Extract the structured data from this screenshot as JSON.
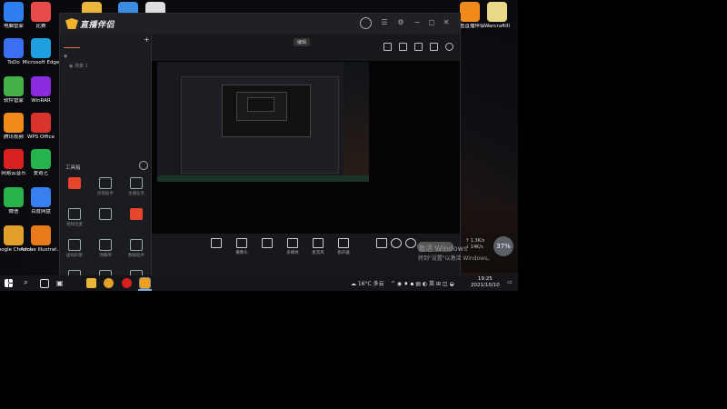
{
  "desktop": {
    "icons": [
      {
        "label": "电脑管家",
        "icon": "shield-icon",
        "color": "#2d7ff0"
      },
      {
        "label": "比赛",
        "icon": "game-icon",
        "color": "#e84a4a"
      },
      {
        "label": "",
        "icon": "folder-icon",
        "color": "#e8b63a"
      },
      {
        "label": "",
        "icon": "app-icon",
        "color": "#3a8de0"
      },
      {
        "label": "",
        "icon": "file-icon",
        "color": "#dddddd"
      },
      {
        "label": "ToDo",
        "icon": "todo-icon",
        "color": "#3a6ff0"
      },
      {
        "label": "Microsoft Edge",
        "icon": "edge-icon",
        "color": "#1fa0e0"
      },
      {
        "label": "软件管家",
        "icon": "software-manager-icon",
        "color": "#43b04a"
      },
      {
        "label": "WinRAR",
        "icon": "winrar-icon",
        "color": "#8a2be2"
      },
      {
        "label": "腾讯视频",
        "icon": "tencent-video-icon",
        "color": "#f08a1a"
      },
      {
        "label": "WPS Office",
        "icon": "wps-icon",
        "color": "#d9332c"
      },
      {
        "label": "网易云音乐",
        "icon": "netease-music-icon",
        "color": "#d8201e"
      },
      {
        "label": "爱奇艺",
        "icon": "iqiyi-icon",
        "color": "#26b24c"
      },
      {
        "label": "微信",
        "icon": "wechat-icon",
        "color": "#2ab24a"
      },
      {
        "label": "百度网盘",
        "icon": "baidu-netdisk-icon",
        "color": "#3a7ff0"
      },
      {
        "label": "Google Chrome",
        "icon": "chrome-icon",
        "color": "#e0a02a"
      },
      {
        "label": "Adobe Illustrat...",
        "icon": "illustrator-icon",
        "color": "#e87a1a"
      },
      {
        "label": "斗鱼直播伴侣",
        "icon": "live-companion-icon",
        "color": "#f08a1a"
      },
      {
        "label": "WarcraftIII",
        "icon": "warcraft-file-icon",
        "color": "#e8d98a"
      }
    ]
  },
  "app": {
    "name": "直播伴侣",
    "left_tabs": [
      "",
      "",
      ""
    ],
    "scenes": [
      "",
      "场景 1"
    ],
    "toolbox_title": "工具箱",
    "tools": [
      {
        "label": "",
        "icon": "camera-icon",
        "hot": true
      },
      {
        "label": "房管助手",
        "icon": "admin-icon",
        "hot": false
      },
      {
        "label": "主播任务",
        "icon": "task-icon",
        "hot": false
      },
      {
        "label": "视频连麦",
        "icon": "video-link-icon",
        "hot": false
      },
      {
        "label": "",
        "icon": "multi-person-icon",
        "hot": false
      },
      {
        "label": "",
        "icon": "hot-tool-icon",
        "hot": true
      },
      {
        "label": "虚拟形象",
        "icon": "avatar-tool-icon",
        "hot": false
      },
      {
        "label": "弹幕库",
        "icon": "danmu-icon",
        "hot": false
      },
      {
        "label": "数据助手",
        "icon": "data-icon",
        "hot": false
      },
      {
        "label": "",
        "icon": "gamepad-icon",
        "hot": false
      },
      {
        "label": "",
        "icon": "download-icon",
        "hot": false
      },
      {
        "label": "",
        "icon": "car-icon",
        "hot": false
      }
    ],
    "notice_prefix": "",
    "notice_text": "",
    "preview": {
      "title": "",
      "edit_label": "编辑",
      "subline": ""
    },
    "bottom_buttons": [
      {
        "label": "",
        "icon": "screen-capture-icon"
      },
      {
        "label": "摄像头",
        "icon": "webcam-icon"
      },
      {
        "label": "",
        "icon": "phone-cast-icon"
      },
      {
        "label": "多媒体",
        "icon": "media-icon"
      },
      {
        "label": "麦克风",
        "icon": "microphone-icon"
      },
      {
        "label": "扬声器",
        "icon": "speaker-icon"
      }
    ],
    "status_line": "",
    "live_button": ""
  },
  "watermark": {
    "line1": "激活 Windows",
    "line2": "转到\"设置\"以激活 Windows。"
  },
  "net_speed": {
    "up": "1.3K/s",
    "down": "14K/s",
    "percent": "37%"
  },
  "taskbar": {
    "weather": "16°C 多云",
    "time": "19:25",
    "date": "2021/10/10"
  }
}
